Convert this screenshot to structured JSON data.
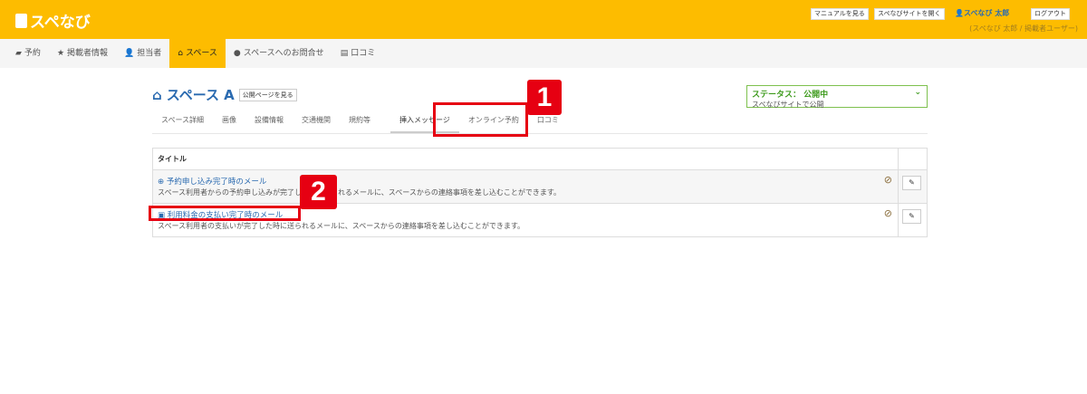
{
  "header": {
    "logo": "スペなび",
    "manual": "マニュアルを見る",
    "open_site": "スペなびサイトを開く",
    "user": "スペなび 太郎",
    "logout": "ログアウト",
    "role": "(スペなび 太郎 / 掲載者ユーザー)",
    "color": "#fdbc00"
  },
  "nav": [
    {
      "label": "予約",
      "icon": "book-icon"
    },
    {
      "label": "掲載者情報",
      "icon": "star-icon"
    },
    {
      "label": "担当者",
      "icon": "user-icon"
    },
    {
      "label": "スペース",
      "icon": "home-icon",
      "active": true
    },
    {
      "label": "スペースへのお問合せ",
      "icon": "comment-icon"
    },
    {
      "label": "口コミ",
      "icon": "review-icon"
    }
  ],
  "page": {
    "title": "スペース A",
    "public_page": "公開ページを見る"
  },
  "status": {
    "label": "ステータス： 公開中",
    "sub": "スペなびサイトで公開"
  },
  "tabs": [
    {
      "label": "スペース詳細"
    },
    {
      "label": "画像"
    },
    {
      "label": "設備情報"
    },
    {
      "label": "交通機関"
    },
    {
      "label": "規約等"
    },
    {
      "label": "挿入メッセージ",
      "active": true
    },
    {
      "label": "オンライン予約"
    },
    {
      "label": "口コミ"
    }
  ],
  "table": {
    "header": "タイトル",
    "rows": [
      {
        "title": "予約申し込み完了時のメール",
        "desc": "スペース利用者からの予約申し込みが完了した時に送られるメールに、スペースからの連絡事項を差し込むことができます。"
      },
      {
        "title": "利用料金の支払い完了時のメール",
        "desc": "スペース利用者の支払いが完了した時に送られるメールに、スペースからの連絡事項を差し込むことができます。"
      }
    ]
  },
  "annotations": [
    "1",
    "2"
  ]
}
